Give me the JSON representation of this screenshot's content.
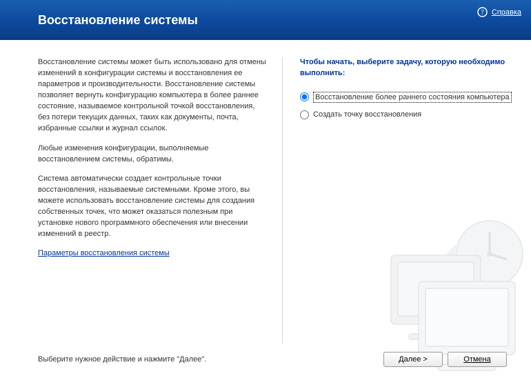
{
  "header": {
    "title": "Восстановление системы",
    "help_link": "Справка"
  },
  "left": {
    "para1": "Восстановление системы может быть использовано для отмены изменений в конфигурации системы и восстановления ее параметров и производительности. Восстановление системы позволяет вернуть конфигурацию компьютера в более раннее состояние, называемое контрольной точкой восстановления, без потери текущих данных, таких как документы, почта, избранные ссылки и журнал ссылок.",
    "para2": "Любые изменения конфигурации, выполняемые восстановлением системы, обратимы.",
    "para3": "Система автоматически создает контрольные точки восстановления, называемые системными. Кроме этого, вы можете использовать восстановление системы для создания собственных точек, что может оказаться полезным при установке нового программного обеспечения или внесении изменений в реестр.",
    "settings_link": "Параметры восстановления системы"
  },
  "right": {
    "prompt": "Чтобы начать, выберите задачу, которую необходимо выполнить:",
    "options": [
      {
        "label": "Восстановление более раннего состояния компьютера",
        "selected": true
      },
      {
        "label": "Создать точку восстановления",
        "selected": false
      }
    ]
  },
  "footer": {
    "hint": "Выберите нужное действие и нажмите \"Далее\".",
    "next": "Далее >",
    "cancel": "Отмена"
  }
}
